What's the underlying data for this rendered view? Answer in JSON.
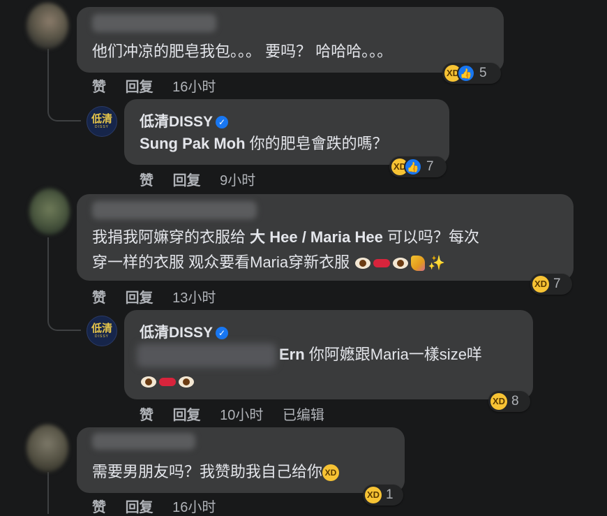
{
  "comments": [
    {
      "text": "他们冲凉的肥皂我包。。。 要吗？ 哈哈哈。。。",
      "actions": {
        "like": "赞",
        "reply": "回复",
        "time": "16小时"
      },
      "reactions": {
        "count": "5",
        "icons": [
          "haha-icon",
          "like-icon"
        ]
      },
      "reply": {
        "author": "低清DISSY",
        "mention": "Sung Pak Moh",
        "text": " 你的肥皂會跌的嗎？",
        "actions": {
          "like": "赞",
          "reply": "回复",
          "time": "9小时"
        },
        "reactions": {
          "count": "7",
          "icons": [
            "haha-icon",
            "like-icon"
          ]
        }
      }
    },
    {
      "text_line1_a": "我捐我阿嫲穿的衣服给 ",
      "mention": "大 Hee / Maria Hee",
      "text_line1_b": " 可以吗？每次",
      "text_line2": "穿一样的衣服 观众要看Maria穿新衣服",
      "actions": {
        "like": "赞",
        "reply": "回复",
        "time": "13小时"
      },
      "reactions": {
        "count": "7",
        "icons": [
          "haha-icon"
        ]
      },
      "reply": {
        "author": "低清DISSY",
        "mention_tail": "Ern",
        "text": " 你阿嬷跟Maria一樣size咩",
        "actions": {
          "like": "赞",
          "reply": "回复",
          "time": "10小时",
          "edited": "已编辑"
        },
        "reactions": {
          "count": "8",
          "icons": [
            "haha-icon"
          ]
        }
      }
    },
    {
      "text": "需要男朋友吗？我赞助我自己给你",
      "actions": {
        "like": "赞",
        "reply": "回复",
        "time": "16小时"
      },
      "reactions": {
        "count": "1",
        "icons": [
          "haha-icon"
        ]
      }
    }
  ],
  "page_logo": {
    "main": "低清",
    "sub": "DISSY"
  },
  "colors": {
    "background": "#18191a",
    "bubble": "#3a3b3c",
    "text": "#e4e6eb",
    "meta": "#b0b3b8",
    "verified": "#1877f2"
  }
}
